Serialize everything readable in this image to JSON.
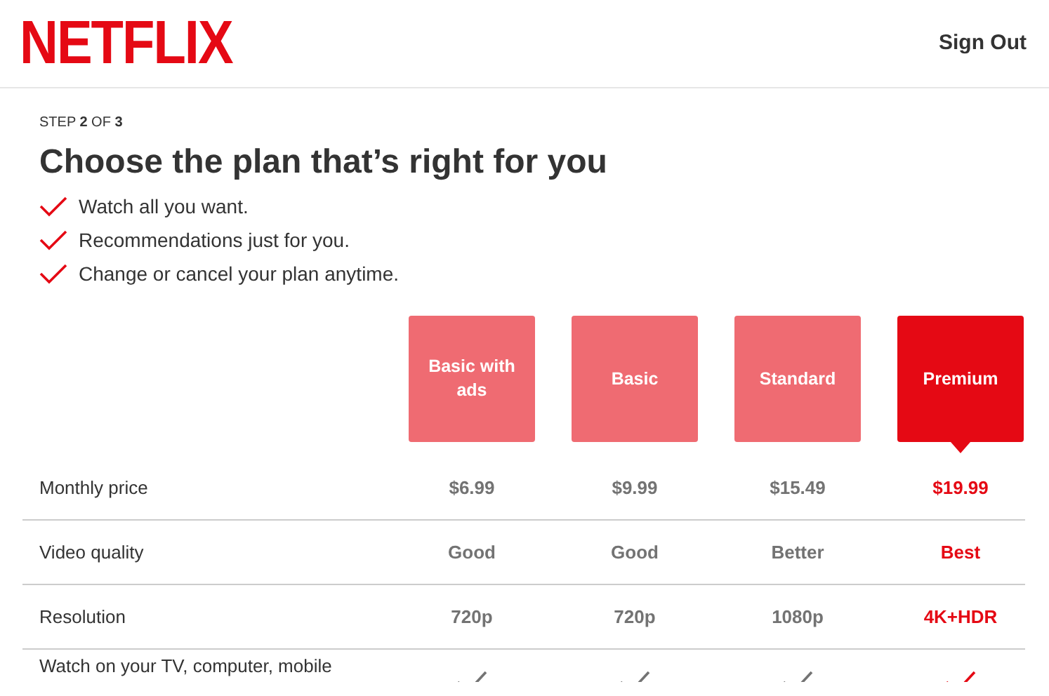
{
  "header": {
    "logo": "NETFLIX",
    "sign_out": "Sign Out"
  },
  "step": "STEP **2** OF **3**",
  "title": "Choose the plan that’s right for you",
  "features": [
    "Watch all you want.",
    "Recommendations just for you.",
    "Change or cancel your plan anytime."
  ],
  "plans": [
    {
      "name": "Basic with ads",
      "selected": false
    },
    {
      "name": "Basic",
      "selected": false
    },
    {
      "name": "Standard",
      "selected": false
    },
    {
      "name": "Premium",
      "selected": true
    }
  ],
  "rows": [
    {
      "kind": "text",
      "label": "Monthly price",
      "values": [
        "$6.99",
        "$9.99",
        "$15.49",
        "$19.99"
      ]
    },
    {
      "kind": "text",
      "label": "Video quality",
      "values": [
        "Good",
        "Good",
        "Better",
        "Best"
      ]
    },
    {
      "kind": "text",
      "label": "Resolution",
      "values": [
        "720p",
        "720p",
        "1080p",
        "4K+HDR"
      ]
    },
    {
      "kind": "check",
      "label": "Watch on your TV, computer, mobile",
      "checks": [
        true,
        true,
        true,
        true
      ]
    }
  ]
}
